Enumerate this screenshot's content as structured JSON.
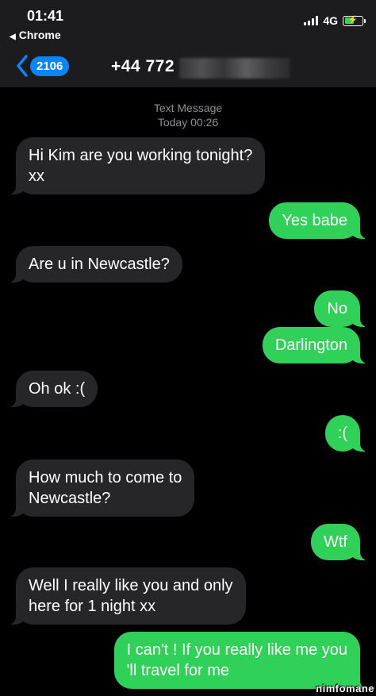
{
  "status": {
    "time": "01:41",
    "back_app": "Chrome",
    "network": "4G"
  },
  "nav": {
    "unread_count": "2106",
    "contact": "+44 772"
  },
  "thread": {
    "service": "Text Message",
    "timestamp": "Today 00:26"
  },
  "messages": [
    {
      "direction": "incoming",
      "text": "Hi Kim are you working tonight?\nxx"
    },
    {
      "direction": "outgoing",
      "text": "Yes babe"
    },
    {
      "direction": "incoming",
      "text": "Are u in Newcastle?"
    },
    {
      "direction": "outgoing",
      "text": "No"
    },
    {
      "direction": "outgoing",
      "text": "Darlington"
    },
    {
      "direction": "incoming",
      "text": "Oh ok :("
    },
    {
      "direction": "outgoing",
      "text": ":("
    },
    {
      "direction": "incoming",
      "text": "How much to come to\nNewcastle?"
    },
    {
      "direction": "outgoing",
      "text": "Wtf"
    },
    {
      "direction": "incoming",
      "text": "Well I really like you and only\nhere for 1 night xx"
    },
    {
      "direction": "outgoing",
      "text": "I can't ! If you really like me you\n'll travel for me"
    }
  ],
  "watermark": "nimfomane",
  "colors": {
    "incoming_bubble": "#262629",
    "outgoing_bubble": "#30d158",
    "accent": "#0a84ff"
  }
}
